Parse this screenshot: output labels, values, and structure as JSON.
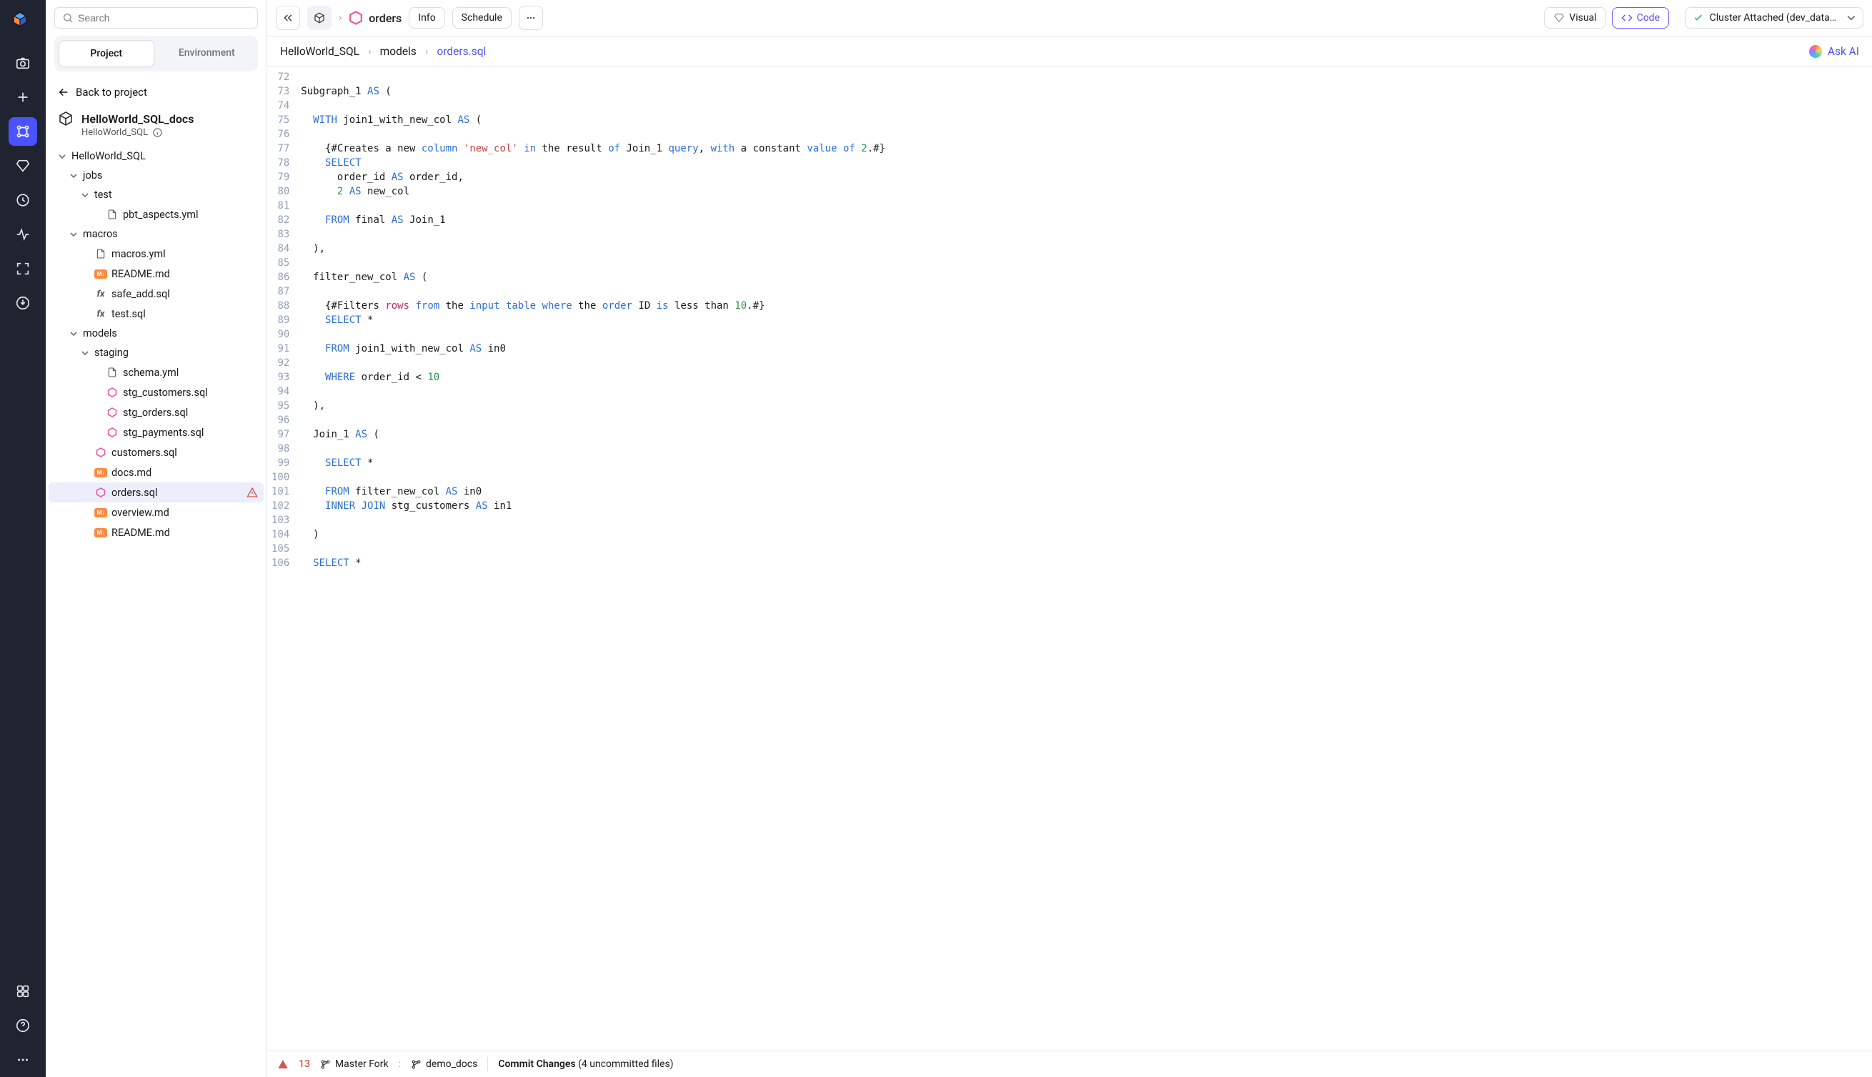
{
  "search": {
    "placeholder": "Search"
  },
  "sidebar_tabs": {
    "project": "Project",
    "environment": "Environment"
  },
  "back_link": "Back to project",
  "project": {
    "title": "HelloWorld_SQL_docs",
    "sub": "HelloWorld_SQL"
  },
  "tree": {
    "root": "HelloWorld_SQL",
    "jobs": "jobs",
    "jobs_test": "test",
    "jobs_test_pbt": "pbt_aspects.yml",
    "macros": "macros",
    "macros_yml": "macros.yml",
    "macros_readme": "README.md",
    "macros_safeadd": "safe_add.sql",
    "macros_test": "test.sql",
    "models": "models",
    "models_staging": "staging",
    "schema": "schema.yml",
    "stg_customers": "stg_customers.sql",
    "stg_orders": "stg_orders.sql",
    "stg_payments": "stg_payments.sql",
    "customers": "customers.sql",
    "docs": "docs.md",
    "orders": "orders.sql",
    "overview": "overview.md",
    "readme": "README.md"
  },
  "topbar": {
    "title": "orders",
    "info": "Info",
    "schedule": "Schedule",
    "visual": "Visual",
    "code": "Code",
    "cluster": "Cluster Attached (dev_databr…"
  },
  "crumbs": {
    "a": "HelloWorld_SQL",
    "b": "models",
    "c": "orders.sql",
    "askai": "Ask AI"
  },
  "gutter_start": 72,
  "gutter_end": 106,
  "code_lines": [
    "",
    "Subgraph_1 <kw>AS</kw> (",
    "",
    "  <kw>WITH</kw> join1_with_new_col <kw>AS</kw> (",
    "",
    "    {#Creates a new <id>column</id> <str>'new_col'</str> <kw>in</kw> the result <id>of</id> Join_1 <id>query</id>, <kw>with</kw> a constant <id>value</id> <id>of</id> <num>2</num>.#}",
    "    <kw>SELECT</kw> ",
    "      order_id <kw>AS</kw> order_id,",
    "      <num>2</num> <kw>AS</kw> new_col",
    "    ",
    "    <kw>FROM</kw> final <kw>AS</kw> Join_1",
    "  ",
    "  ),",
    "",
    "  filter_new_col <kw>AS</kw> (",
    "",
    "    {#Filters <fn>rows</fn> <kw>from</kw> the <id>input</id> <id>table</id> <kw>where</kw> the <id>order</id> ID <kw>is</kw> less than <num>10</num>.#}",
    "    <kw>SELECT</kw> * ",
    "    ",
    "    <kw>FROM</kw> join1_with_new_col <kw>AS</kw> in0",
    "    ",
    "    <kw>WHERE</kw> order_id &lt; <num>10</num>",
    "  ",
    "  ),",
    "",
    "  Join_1 <kw>AS</kw> (",
    "",
    "    <kw>SELECT</kw> * ",
    "    ",
    "    <kw>FROM</kw> filter_new_col <kw>AS</kw> in0",
    "    <kw>INNER</kw> <kw>JOIN</kw> stg_customers <kw>AS</kw> in1",
    "  ",
    "  )",
    "",
    "  <kw>SELECT</kw> *"
  ],
  "bottom": {
    "warn_count": "13",
    "branch_a": "Master Fork",
    "sep": ":",
    "branch_b": "demo_docs",
    "commit_label": "Commit Changes",
    "commit_info": " (4 uncommitted files)"
  }
}
